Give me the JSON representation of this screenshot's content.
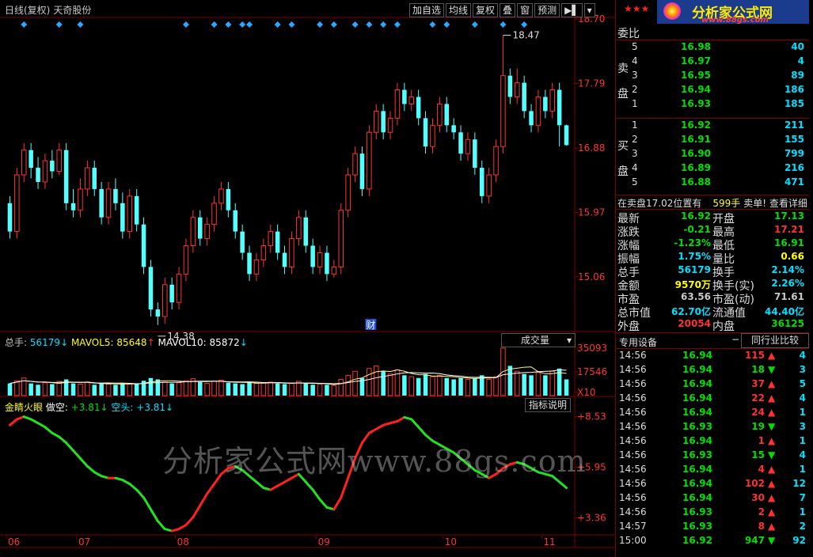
{
  "header": {
    "title": "日线(复权)",
    "stock_name": "天奇股份",
    "buttons": [
      "加自选",
      "均线",
      "复权",
      "叠",
      "窗",
      "预测"
    ],
    "arrow_btn": "▶▌",
    "dropdown_arrow": "▾"
  },
  "price_axis": [
    "18.70",
    "17.79",
    "16.88",
    "15.97",
    "15.06"
  ],
  "annotations": {
    "high": "18.47",
    "low": "14.38",
    "cai": "财"
  },
  "volume": {
    "head_total_label": "总手:",
    "head_total_value": "56179",
    "mavol5_label": "MAVOL5:",
    "mavol5_value": "85648",
    "mavol10_label": "MAVOL10:",
    "mavol10_value": "85872",
    "up_arrow": "↑",
    "down_arrow": "↓",
    "selector": "成交量",
    "axis": [
      "35093",
      "17546",
      "X10"
    ]
  },
  "indicator": {
    "name": "金睛火眼",
    "duo_label": "做空:",
    "duo_value": "+3.81",
    "kong_label": "空头:",
    "kong_value": "+3.81",
    "down_arrow": "↓",
    "button": "指标说明",
    "axis": [
      "+8.53",
      "+5.95",
      "+3.36"
    ]
  },
  "xaxis": [
    "06",
    "07",
    "08",
    "09",
    "10",
    "11"
  ],
  "watermark": "分析家公式网www.88gs.com",
  "logo": {
    "stars": "★★★",
    "name": "分析家公式网",
    "url": "www.88gs.com"
  },
  "colors": {
    "up": "#ff3232",
    "down": "#54ffff",
    "green": "#00e000",
    "axis": "#800000"
  },
  "chart_data": {
    "type": "candlestick",
    "title": "天奇股份 日线(复权)",
    "ylim": [
      14.3,
      18.7
    ],
    "x_ticks": [
      "06",
      "07",
      "08",
      "09",
      "10",
      "11"
    ],
    "candles": [
      [
        16.1,
        15.7,
        16.2,
        15.6
      ],
      [
        15.7,
        16.5,
        16.6,
        15.6
      ],
      [
        16.5,
        16.85,
        16.95,
        16.4
      ],
      [
        16.85,
        16.6,
        16.95,
        16.45
      ],
      [
        16.6,
        16.4,
        16.75,
        16.3
      ],
      [
        16.4,
        16.7,
        16.8,
        16.3
      ],
      [
        16.7,
        16.55,
        16.85,
        16.45
      ],
      [
        16.55,
        16.85,
        16.95,
        16.5
      ],
      [
        16.85,
        16.1,
        16.95,
        16.0
      ],
      [
        16.1,
        16.0,
        16.3,
        15.9
      ],
      [
        16.0,
        16.3,
        16.45,
        15.9
      ],
      [
        16.3,
        16.6,
        16.7,
        16.2
      ],
      [
        16.6,
        16.3,
        16.7,
        16.2
      ],
      [
        16.3,
        15.9,
        16.4,
        15.8
      ],
      [
        15.9,
        16.3,
        16.4,
        15.8
      ],
      [
        16.3,
        16.1,
        16.45,
        16.0
      ],
      [
        16.1,
        15.7,
        16.25,
        15.6
      ],
      [
        15.7,
        16.2,
        16.3,
        15.6
      ],
      [
        16.2,
        15.8,
        16.3,
        15.7
      ],
      [
        15.8,
        15.2,
        15.9,
        15.1
      ],
      [
        15.2,
        14.6,
        15.3,
        14.5
      ],
      [
        14.6,
        14.5,
        14.7,
        14.38
      ],
      [
        14.5,
        14.95,
        15.05,
        14.4
      ],
      [
        14.95,
        14.7,
        15.05,
        14.6
      ],
      [
        14.7,
        15.1,
        15.2,
        14.6
      ],
      [
        15.1,
        15.5,
        15.6,
        15.0
      ],
      [
        15.5,
        15.9,
        16.0,
        15.4
      ],
      [
        15.9,
        15.6,
        16.0,
        15.5
      ],
      [
        15.6,
        15.8,
        15.9,
        15.5
      ],
      [
        15.8,
        16.1,
        16.2,
        15.7
      ],
      [
        16.1,
        16.3,
        16.4,
        16.0
      ],
      [
        16.3,
        16.0,
        16.4,
        15.9
      ],
      [
        16.0,
        15.7,
        16.1,
        15.6
      ],
      [
        15.7,
        15.4,
        15.8,
        15.3
      ],
      [
        15.4,
        15.1,
        15.5,
        15.0
      ],
      [
        15.1,
        15.3,
        15.4,
        15.0
      ],
      [
        15.3,
        15.5,
        15.6,
        15.2
      ],
      [
        15.5,
        15.7,
        15.8,
        15.4
      ],
      [
        15.7,
        15.4,
        15.8,
        15.3
      ],
      [
        15.4,
        15.2,
        15.5,
        15.1
      ],
      [
        15.2,
        15.6,
        15.7,
        15.1
      ],
      [
        15.6,
        15.9,
        16.0,
        15.5
      ],
      [
        15.9,
        15.5,
        16.0,
        15.4
      ],
      [
        15.5,
        15.2,
        15.6,
        15.1
      ],
      [
        15.2,
        15.4,
        15.5,
        15.1
      ],
      [
        15.4,
        15.1,
        15.5,
        15.0
      ],
      [
        15.1,
        15.2,
        15.3,
        15.05
      ],
      [
        15.2,
        16.0,
        16.1,
        15.1
      ],
      [
        16.0,
        16.5,
        16.6,
        15.9
      ],
      [
        16.5,
        16.8,
        16.9,
        16.4
      ],
      [
        16.8,
        16.3,
        16.9,
        16.2
      ],
      [
        16.3,
        17.1,
        17.2,
        16.2
      ],
      [
        17.1,
        17.4,
        17.5,
        17.0
      ],
      [
        17.4,
        17.1,
        17.5,
        17.0
      ],
      [
        17.1,
        17.3,
        17.4,
        17.0
      ],
      [
        17.3,
        17.7,
        17.8,
        17.2
      ],
      [
        17.7,
        17.5,
        17.8,
        17.4
      ],
      [
        17.5,
        17.6,
        17.7,
        17.4
      ],
      [
        17.6,
        17.3,
        17.7,
        17.2
      ],
      [
        17.3,
        16.9,
        17.4,
        16.8
      ],
      [
        16.9,
        17.2,
        17.3,
        16.8
      ],
      [
        17.2,
        17.5,
        17.6,
        17.1
      ],
      [
        17.5,
        17.2,
        17.6,
        17.1
      ],
      [
        17.2,
        17.1,
        17.3,
        17.0
      ],
      [
        17.1,
        16.8,
        17.2,
        16.7
      ],
      [
        16.8,
        17.0,
        17.1,
        16.7
      ],
      [
        17.0,
        16.6,
        17.1,
        16.5
      ],
      [
        16.6,
        16.2,
        16.7,
        16.1
      ],
      [
        16.2,
        16.5,
        16.6,
        16.1
      ],
      [
        16.5,
        16.9,
        17.0,
        16.4
      ],
      [
        16.9,
        17.9,
        18.47,
        16.8
      ],
      [
        17.9,
        17.6,
        18.0,
        17.5
      ],
      [
        17.6,
        17.8,
        18.0,
        17.5
      ],
      [
        17.8,
        17.4,
        17.9,
        17.3
      ],
      [
        17.4,
        17.2,
        17.5,
        17.1
      ],
      [
        17.2,
        17.6,
        17.7,
        17.1
      ],
      [
        17.6,
        17.4,
        17.7,
        17.3
      ],
      [
        17.4,
        17.7,
        17.8,
        17.3
      ],
      [
        17.7,
        17.2,
        17.8,
        16.9
      ],
      [
        17.2,
        16.92,
        17.21,
        16.91
      ]
    ],
    "volume_ylim": [
      0,
      35093
    ],
    "volume": [
      9000,
      11000,
      13000,
      9000,
      8000,
      9500,
      8500,
      10500,
      12000,
      9000,
      8500,
      10000,
      8000,
      9000,
      8500,
      8000,
      9000,
      8500,
      9000,
      11000,
      13000,
      12000,
      10000,
      9000,
      9500,
      11000,
      12500,
      10000,
      9000,
      10500,
      11500,
      9500,
      9000,
      8500,
      10000,
      9000,
      9500,
      10000,
      9000,
      8500,
      9000,
      10500,
      9000,
      8000,
      8500,
      8000,
      7500,
      12000,
      15000,
      18000,
      13000,
      20000,
      22000,
      18000,
      16000,
      19000,
      15000,
      14000,
      13000,
      16000,
      14000,
      15000,
      13000,
      12000,
      13000,
      12000,
      13000,
      15000,
      12000,
      14000,
      35093,
      22000,
      18000,
      16000,
      15000,
      17000,
      15000,
      18000,
      20000,
      12000
    ],
    "indicator_ylim": [
      2.5,
      8.8
    ],
    "indicator": [
      8.1,
      8.4,
      8.53,
      8.4,
      8.2,
      8.0,
      7.7,
      7.5,
      7.2,
      6.8,
      6.4,
      6.0,
      5.7,
      5.5,
      5.4,
      5.4,
      5.3,
      5.1,
      4.8,
      4.4,
      3.8,
      3.2,
      2.8,
      2.7,
      2.8,
      3.0,
      3.4,
      4.0,
      4.6,
      5.1,
      5.6,
      5.9,
      6.0,
      5.8,
      5.5,
      5.2,
      4.9,
      4.8,
      5.0,
      5.2,
      5.4,
      5.6,
      5.2,
      4.8,
      4.3,
      3.9,
      3.8,
      4.4,
      5.4,
      6.4,
      7.2,
      7.7,
      7.9,
      8.1,
      8.2,
      8.3,
      8.5,
      8.4,
      8.0,
      7.6,
      7.3,
      7.1,
      6.9,
      6.7,
      6.4,
      6.1,
      5.8,
      5.6,
      5.4,
      5.6,
      5.9,
      6.1,
      6.2,
      6.1,
      5.9,
      5.7,
      5.6,
      5.5,
      5.2,
      4.9
    ]
  },
  "orderbook": {
    "header": "委比",
    "sell_label": [
      "卖",
      "盘"
    ],
    "buy_label": [
      "买",
      "盘"
    ],
    "sell": [
      {
        "n": "5",
        "p": "16.98",
        "v": "40"
      },
      {
        "n": "4",
        "p": "16.97",
        "v": "4"
      },
      {
        "n": "3",
        "p": "16.95",
        "v": "89"
      },
      {
        "n": "2",
        "p": "16.94",
        "v": "186"
      },
      {
        "n": "1",
        "p": "16.93",
        "v": "185"
      }
    ],
    "buy": [
      {
        "n": "1",
        "p": "16.92",
        "v": "211"
      },
      {
        "n": "2",
        "p": "16.91",
        "v": "155"
      },
      {
        "n": "3",
        "p": "16.90",
        "v": "799"
      },
      {
        "n": "4",
        "p": "16.89",
        "v": "216"
      },
      {
        "n": "5",
        "p": "16.88",
        "v": "471"
      }
    ],
    "notice_a": "在卖盘17.02位置有",
    "notice_b": "599手",
    "notice_c": "卖单! 查看详细"
  },
  "quote": [
    {
      "l": "最新",
      "v": "16.92",
      "vc": "green",
      "l2": "开盘",
      "v2": "17.13",
      "v2c": "green"
    },
    {
      "l": "涨跌",
      "v": "-0.21",
      "vc": "green",
      "l2": "最高",
      "v2": "17.21",
      "v2c": "red"
    },
    {
      "l": "涨幅",
      "v": "-1.23%",
      "vc": "green",
      "l2": "最低",
      "v2": "16.91",
      "v2c": "green"
    },
    {
      "l": "振幅",
      "v": "1.75%",
      "vc": "cyan",
      "l2": "量比",
      "v2": "0.66",
      "v2c": "yellow"
    },
    {
      "l": "总手",
      "v": "56179",
      "vc": "cyan",
      "l2": "换手",
      "v2": "2.14%",
      "v2c": "cyan"
    },
    {
      "l": "金额",
      "v": "9570万",
      "vc": "yellow",
      "l2": "换手(实)",
      "v2": "2.26%",
      "v2c": "cyan"
    },
    {
      "l": "市盈",
      "v": "63.56",
      "vc": "gray",
      "l2": "市盈(动)",
      "v2": "71.61",
      "v2c": "gray"
    },
    {
      "l": "总市值",
      "v": "62.70亿",
      "vc": "cyan",
      "l2": "流通值",
      "v2": "44.40亿",
      "v2c": "cyan"
    },
    {
      "l": "外盘",
      "v": "20054",
      "vc": "red",
      "l2": "内盘",
      "v2": "36125",
      "v2c": "green"
    }
  ],
  "tabs": {
    "left": "专用设备",
    "minus": "−",
    "right": "同行业比较"
  },
  "ticks": [
    {
      "t": "14:56",
      "p": "16.94",
      "pc": "green",
      "v": "115",
      "d": "up",
      "c": "4"
    },
    {
      "t": "14:56",
      "p": "16.94",
      "pc": "green",
      "v": "18",
      "d": "down",
      "c": "3"
    },
    {
      "t": "14:56",
      "p": "16.94",
      "pc": "green",
      "v": "37",
      "d": "up",
      "c": "5"
    },
    {
      "t": "14:56",
      "p": "16.94",
      "pc": "green",
      "v": "22",
      "d": "up",
      "c": "4"
    },
    {
      "t": "14:56",
      "p": "16.94",
      "pc": "green",
      "v": "24",
      "d": "up",
      "c": "1"
    },
    {
      "t": "14:56",
      "p": "16.93",
      "pc": "green",
      "v": "19",
      "d": "down",
      "c": "3"
    },
    {
      "t": "14:56",
      "p": "16.94",
      "pc": "green",
      "v": "1",
      "d": "up",
      "c": "1"
    },
    {
      "t": "14:56",
      "p": "16.93",
      "pc": "green",
      "v": "15",
      "d": "down",
      "c": "4"
    },
    {
      "t": "14:56",
      "p": "16.94",
      "pc": "green",
      "v": "4",
      "d": "up",
      "c": "1"
    },
    {
      "t": "14:56",
      "p": "16.94",
      "pc": "green",
      "v": "102",
      "d": "up",
      "c": "12"
    },
    {
      "t": "14:56",
      "p": "16.94",
      "pc": "green",
      "v": "30",
      "d": "up",
      "c": "7"
    },
    {
      "t": "14:56",
      "p": "16.93",
      "pc": "green",
      "v": "2",
      "d": "up",
      "c": "1"
    },
    {
      "t": "14:57",
      "p": "16.93",
      "pc": "green",
      "v": "8",
      "d": "up",
      "c": "2"
    },
    {
      "t": "15:00",
      "p": "16.92",
      "pc": "green",
      "v": "947",
      "d": "down",
      "c": "92"
    }
  ]
}
